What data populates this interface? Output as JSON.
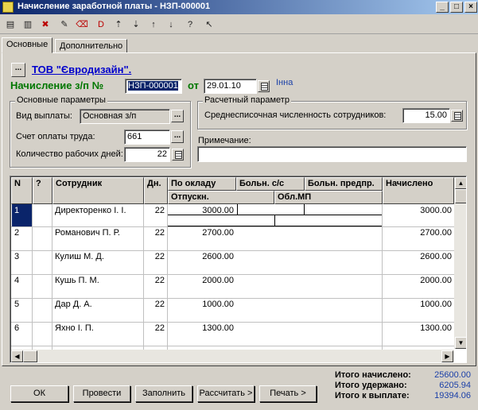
{
  "window": {
    "title": "Начисление заработной платы - НЗП-000001"
  },
  "tabs": [
    {
      "label": "Основные"
    },
    {
      "label": "Дополнительно"
    }
  ],
  "header": {
    "ellipsis": "...",
    "company": "ТОВ \"Євродизайн\".",
    "doc_label": "Начисление з/п №",
    "doc_number": "НЗП-000001",
    "date_label": "от",
    "date": "29.01.10",
    "user": "Інна"
  },
  "main_params": {
    "title": "Основные параметры",
    "payment_type_label": "Вид выплаты:",
    "payment_type": "Основная з/п",
    "account_label": "Счет оплаты труда:",
    "account": "661",
    "workdays_label": "Количество рабочих дней:",
    "workdays": "22"
  },
  "calc_params": {
    "title": "Расчетный параметр",
    "avg_label": "Среднесписочная численность сотрудников:",
    "avg_value": "15.00"
  },
  "note": {
    "label": "Примечание:",
    "value": ""
  },
  "table": {
    "headers": {
      "n": "N",
      "q": "?",
      "employee": "Сотрудник",
      "days": "Дн.",
      "salary": "По окладу",
      "sick_ss": "Больн. с/с",
      "sick_ent": "Больн. предпр.",
      "vacation": "Отпускн.",
      "obl_mp": "Обл.МП",
      "accrued": "Начислено"
    },
    "rows": [
      {
        "n": "1",
        "employee": "Директоренко І. І.",
        "days": "22",
        "salary": "3000.00",
        "accrued": "3000.00"
      },
      {
        "n": "2",
        "employee": "Романович П. Р.",
        "days": "22",
        "salary": "2700.00",
        "accrued": "2700.00"
      },
      {
        "n": "3",
        "employee": "Кулиш М. Д.",
        "days": "22",
        "salary": "2600.00",
        "accrued": "2600.00"
      },
      {
        "n": "4",
        "employee": "Кушь П. М.",
        "days": "22",
        "salary": "2000.00",
        "accrued": "2000.00"
      },
      {
        "n": "5",
        "employee": "Дар Д. А.",
        "days": "22",
        "salary": "1000.00",
        "accrued": "1000.00"
      },
      {
        "n": "6",
        "employee": "Яхно І. П.",
        "days": "22",
        "salary": "1300.00",
        "accrued": "1300.00"
      }
    ]
  },
  "totals": {
    "accrued_label": "Итого начислено:",
    "accrued": "25600.00",
    "withheld_label": "Итого удержано:",
    "withheld": "6205.94",
    "payable_label": "Итого к выплате:",
    "payable": "19394.06"
  },
  "buttons": {
    "ok": "ОК",
    "post": "Провести",
    "fill": "Заполнить",
    "calculate": "Рассчитать >",
    "print": "Печать >"
  },
  "colors": {
    "title_gradient_start": "#0a246a",
    "doc_label": "#007700",
    "company_link": "#0000cc",
    "totals_value": "#1a3fa8",
    "selection": "#0a246a"
  }
}
